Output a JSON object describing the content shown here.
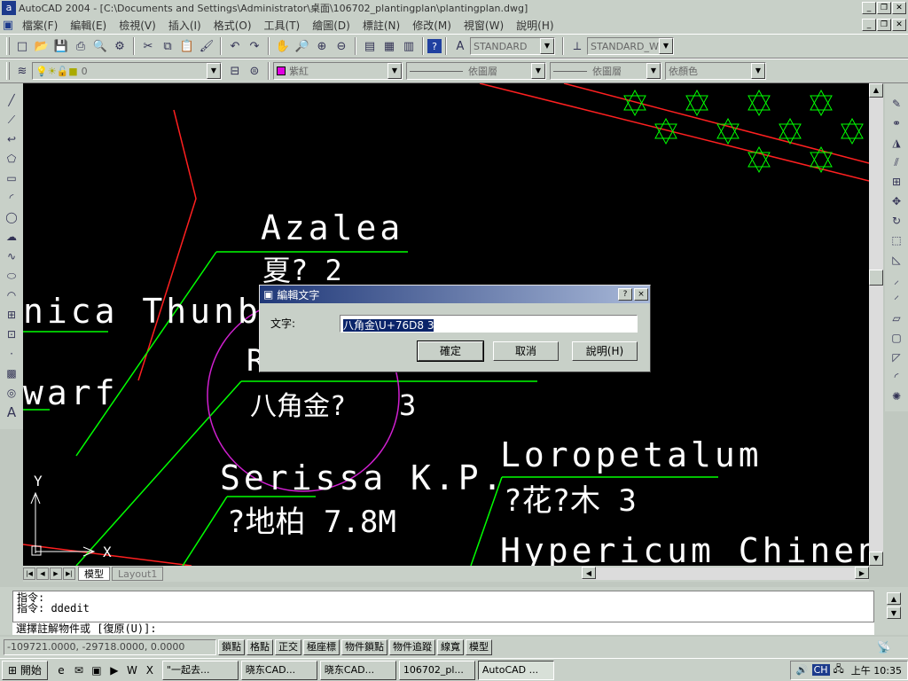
{
  "window": {
    "title": "AutoCAD 2004 - [C:\\Documents and Settings\\Administrator\\桌面\\106702_plantingplan\\plantingplan.dwg]",
    "app_icon": "a"
  },
  "menu": [
    "檔案(F)",
    "編輯(E)",
    "檢視(V)",
    "插入(I)",
    "格式(O)",
    "工具(T)",
    "繪圖(D)",
    "標註(N)",
    "修改(M)",
    "視窗(W)",
    "說明(H)"
  ],
  "styles": {
    "text_style": "STANDARD",
    "dim_style": "STANDARD_W"
  },
  "layers": {
    "current_layer": "0",
    "color": "紫紅",
    "linetype": "依圖層",
    "lineweight": "依圖層",
    "plotstyle": "依顏色"
  },
  "drawing": {
    "texts": [
      "Azalea",
      "夏? 2",
      "nica Thunb",
      "warf",
      "R",
      "八角金?",
      "3",
      "Serissa K.P.",
      "?地柏 7.8M",
      "Loropetalum",
      "?花?木 3",
      "Hypericum Chinen"
    ],
    "ucs_x": "X",
    "ucs_y": "Y"
  },
  "tabs": {
    "model": "模型",
    "layout": "Layout1"
  },
  "command": {
    "line1": "指令:",
    "line2": "指令: ddedit",
    "prompt": "選擇註解物件或 [復原(U)]:"
  },
  "status": {
    "coords": "-109721.0000, -29718.0000, 0.0000",
    "toggles": [
      "鎖點",
      "格點",
      "正交",
      "極座標",
      "物件鎖點",
      "物件追蹤",
      "線寬",
      "模型"
    ]
  },
  "dialog": {
    "title": "編輯文字",
    "help_icon": "?",
    "close_icon": "×",
    "text_label": "文字:",
    "text_value": "八角金\\U+76D8 3",
    "ok": "確定",
    "cancel": "取消",
    "help": "說明(H)"
  },
  "taskbar": {
    "start": "開始",
    "tasks": [
      "\"一起去...",
      "晓东CAD...",
      "晓东CAD...",
      "106702_pl...",
      "AutoCAD ..."
    ],
    "tray_ime": "CH",
    "time": "上午 10:35"
  }
}
